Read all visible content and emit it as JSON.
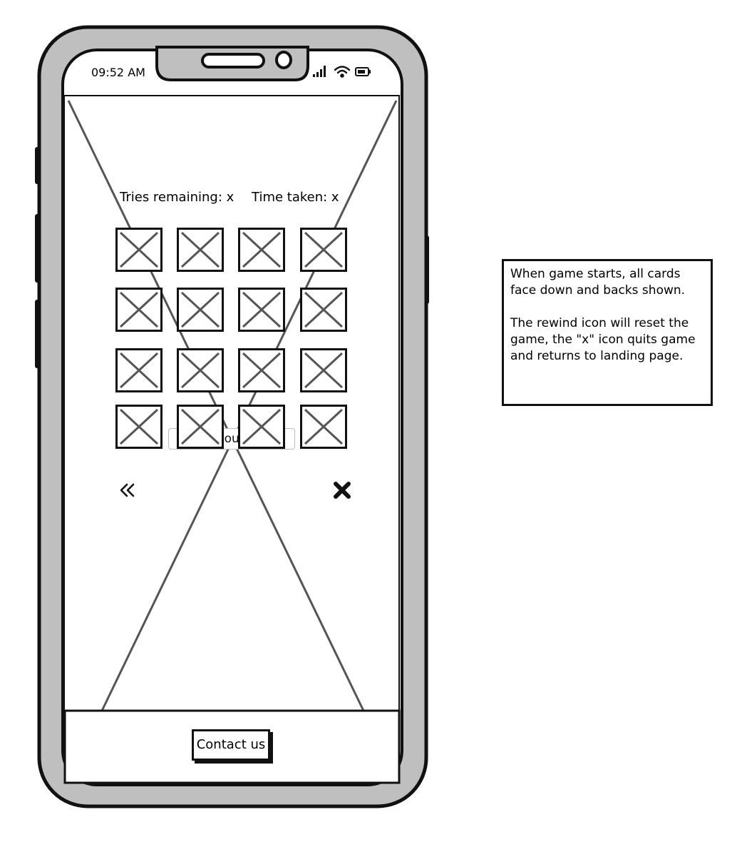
{
  "status_bar": {
    "time": "09:52 AM",
    "icons": [
      "signal-icon",
      "wifi-icon",
      "battery-icon"
    ]
  },
  "game": {
    "tries_label": "Tries remaining: x",
    "time_label": "Time taken: x",
    "card_count": 16,
    "card_state": "face-down",
    "hidden_button_label": "Enter your name"
  },
  "controls": {
    "rewind_icon": "rewind-icon",
    "close_icon": "close-icon"
  },
  "footer": {
    "contact_label": "Contact us"
  },
  "annotation": {
    "line1": "When game starts, all cards face down and backs shown.",
    "line2": "The rewind icon will reset the game, the \"x\" icon quits game and returns to landing page."
  },
  "colors": {
    "phone_frame": "#c0bfc0",
    "outline": "#111111",
    "placeholder_cross": "#555555"
  }
}
